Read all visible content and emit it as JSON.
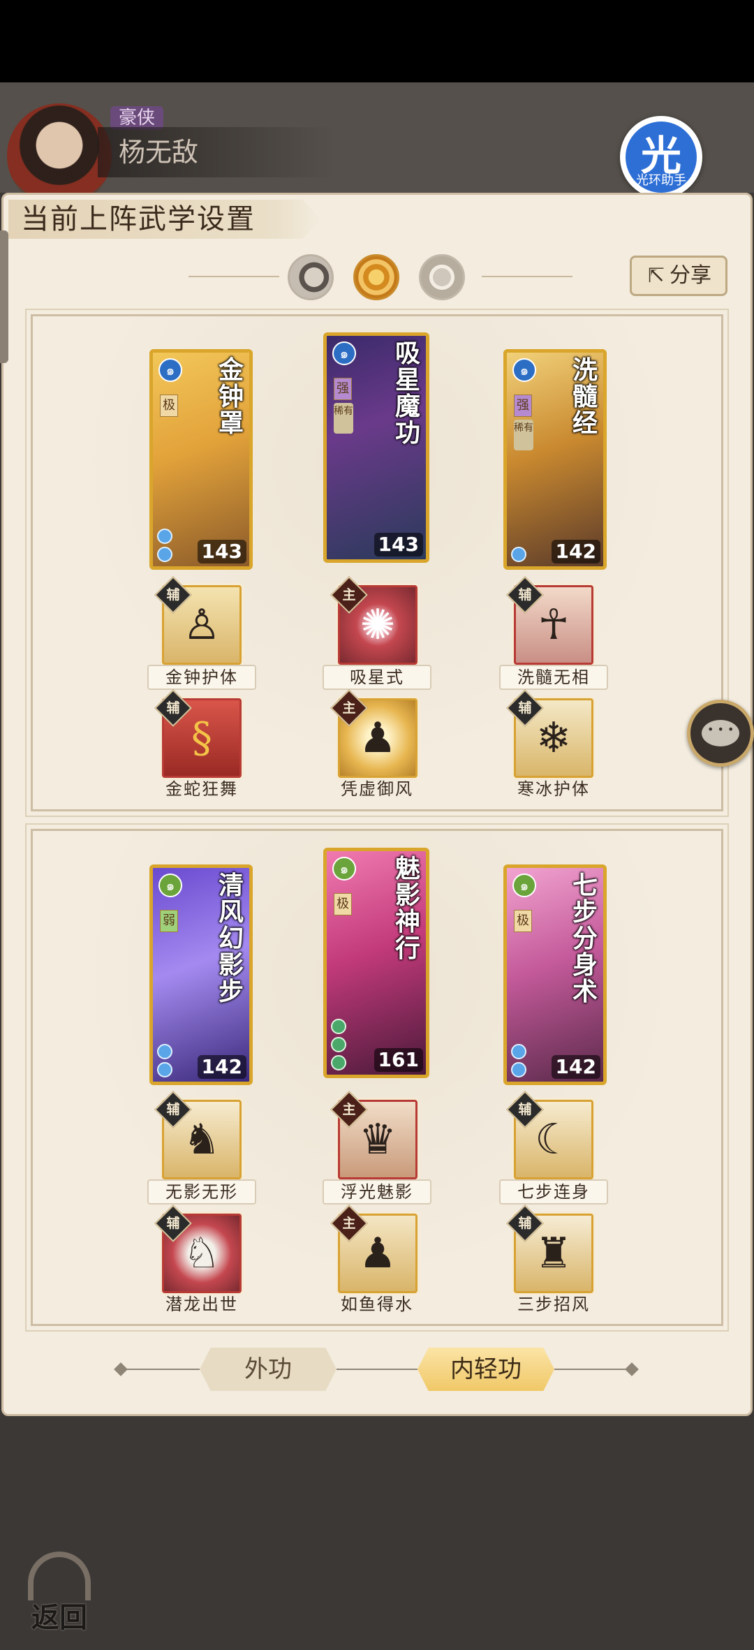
{
  "header": {
    "rank": "豪侠",
    "player_name": "杨无敌"
  },
  "helper": {
    "glyph": "光",
    "caption": "光环助手"
  },
  "panel": {
    "title": "当前上阵武学设置",
    "share_label": "分享"
  },
  "groups": [
    {
      "cards": [
        {
          "name": "金钟罩",
          "power": "143",
          "element": "blue",
          "grade": "极",
          "rare": ""
        },
        {
          "name": "吸星魔功",
          "power": "143",
          "element": "blue",
          "grade": "强",
          "rare": "稀有"
        },
        {
          "name": "洗髓经",
          "power": "142",
          "element": "blue",
          "grade": "强",
          "rare": "稀有"
        }
      ],
      "skills_row1": [
        {
          "tag": "辅",
          "label": "金钟护体"
        },
        {
          "tag": "主",
          "label": "吸星式"
        },
        {
          "tag": "辅",
          "label": "洗髓无相"
        }
      ],
      "skills_row2": [
        {
          "tag": "辅",
          "label": "金蛇狂舞"
        },
        {
          "tag": "主",
          "label": "凭虚御风"
        },
        {
          "tag": "辅",
          "label": "寒冰护体"
        }
      ]
    },
    {
      "cards": [
        {
          "name": "清风幻影步",
          "power": "142",
          "element": "green",
          "grade": "弱",
          "rare": ""
        },
        {
          "name": "魅影神行",
          "power": "161",
          "element": "green",
          "grade": "极",
          "rare": ""
        },
        {
          "name": "七步分身术",
          "power": "142",
          "element": "green",
          "grade": "极",
          "rare": ""
        }
      ],
      "skills_row1": [
        {
          "tag": "辅",
          "label": "无影无形"
        },
        {
          "tag": "主",
          "label": "浮光魅影"
        },
        {
          "tag": "辅",
          "label": "七步连身"
        }
      ],
      "skills_row2": [
        {
          "tag": "辅",
          "label": "潜龙出世"
        },
        {
          "tag": "主",
          "label": "如鱼得水"
        },
        {
          "tag": "辅",
          "label": "三步招风"
        }
      ]
    }
  ],
  "tabs": {
    "outer": "外功",
    "inner": "内轻功"
  },
  "back_label": "返回"
}
